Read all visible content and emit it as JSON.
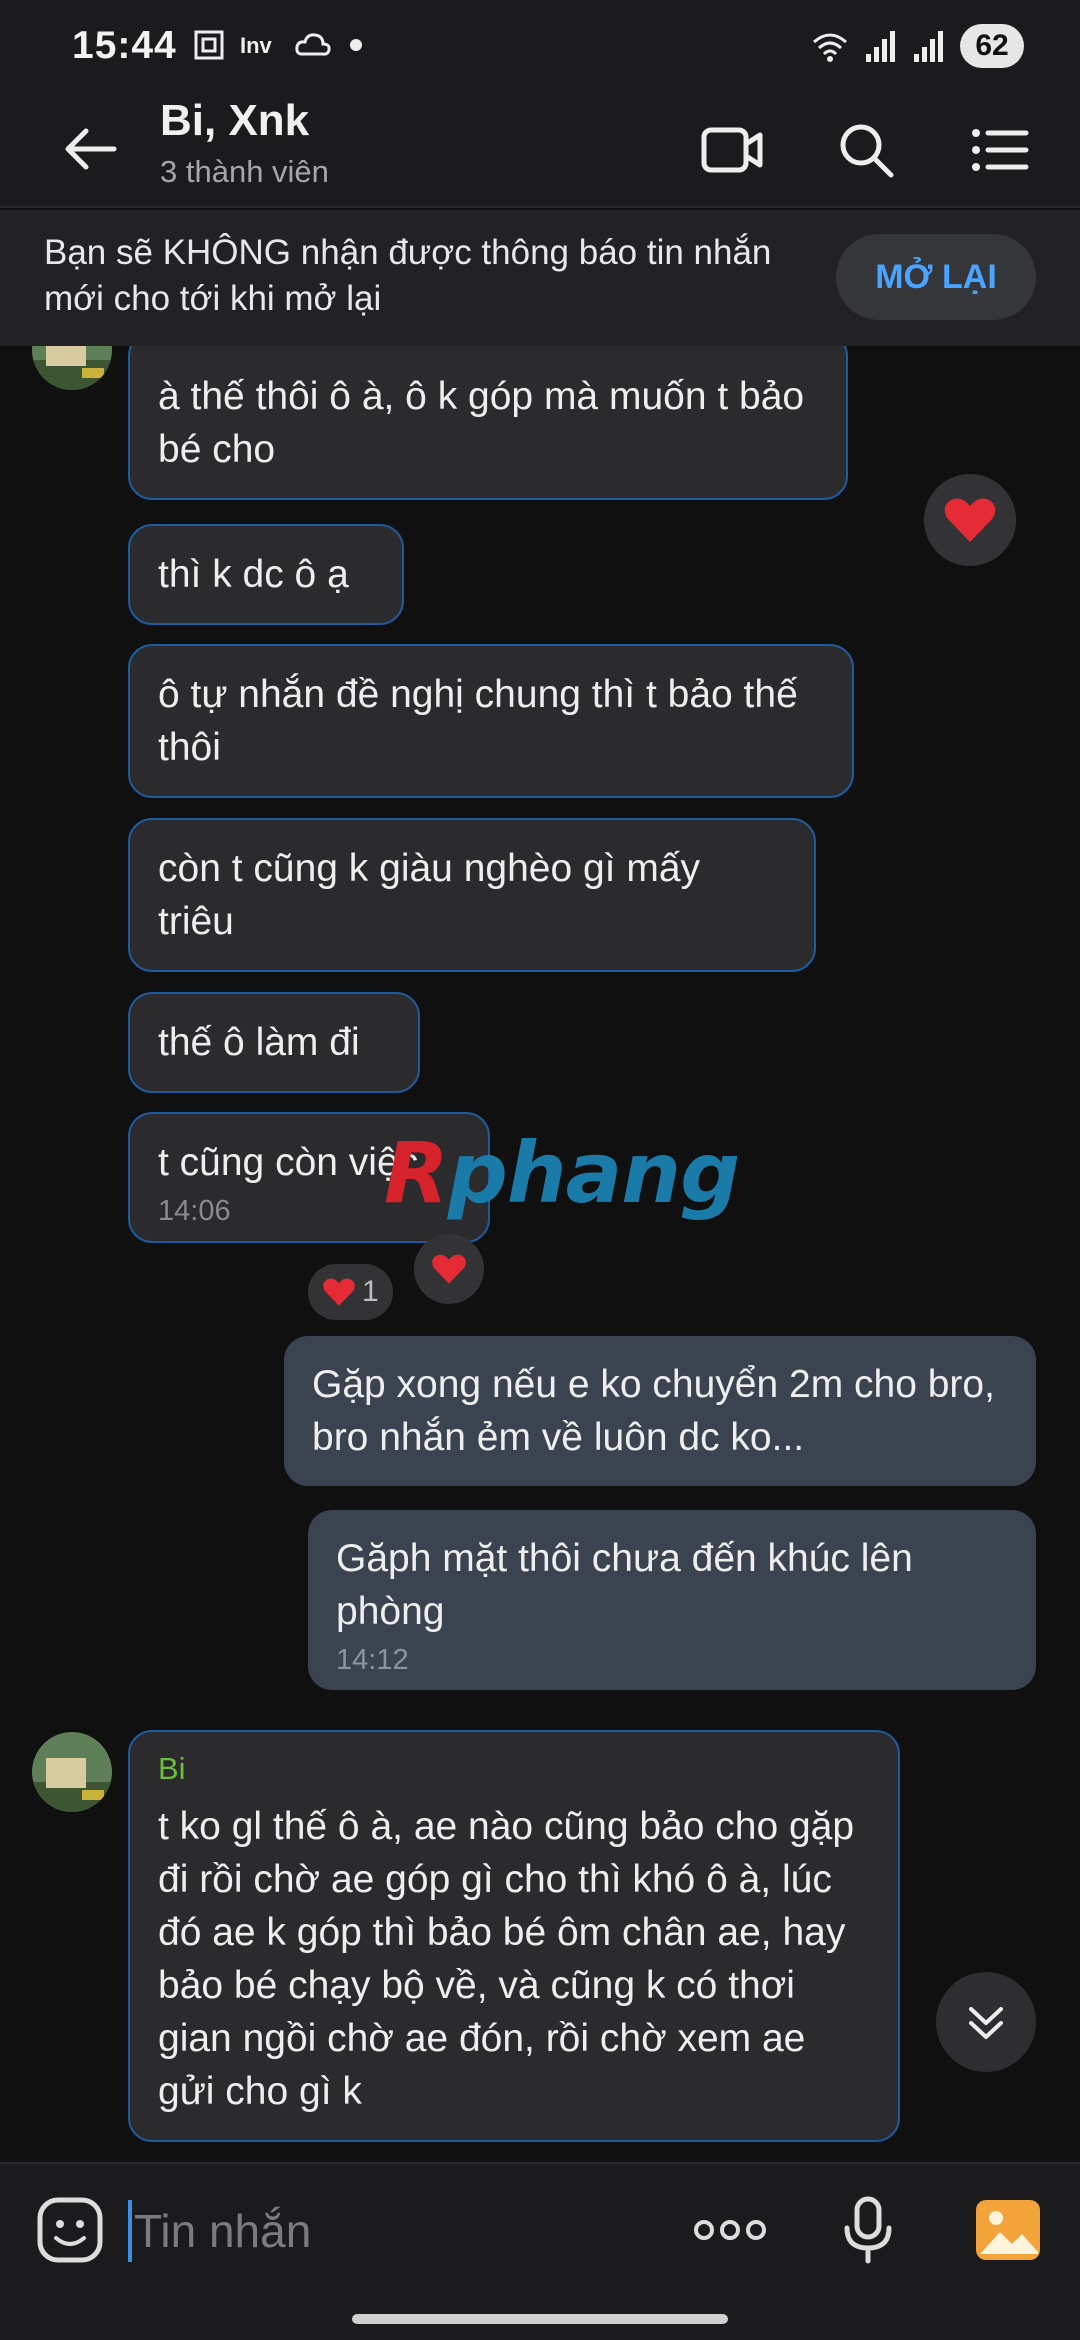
{
  "status": {
    "time": "15:44",
    "battery": "62",
    "left_icons": [
      "screenshot-icon",
      "inv-icon",
      "cloud-icon",
      "dot-icon"
    ],
    "right_icons": [
      "wifi-icon",
      "signal-icon",
      "signal-icon"
    ]
  },
  "header": {
    "title": "Bi, Xnk",
    "subtitle": "3 thành viên",
    "actions": [
      "video-call",
      "search",
      "menu"
    ]
  },
  "banner": {
    "text": "Bạn sẽ KHÔNG nhận được thông báo tin nhắn mới cho tới khi mở lại",
    "button": "MỞ LẠI"
  },
  "messages": [
    {
      "from": "in",
      "text": "à thế thôi ô à, ô k góp mà muốn t bảo bé cho"
    },
    {
      "from": "in",
      "text": "thì k dc ô ạ"
    },
    {
      "from": "in",
      "text": "ô tự nhắn đề nghị chung thì t bảo thế thôi"
    },
    {
      "from": "in",
      "text": "còn t cũng k giàu nghèo gì mấy triêu"
    },
    {
      "from": "in",
      "text": "thế ô làm đi"
    },
    {
      "from": "in",
      "text": "t cũng còn việc",
      "time": "14:06",
      "reaction_count": "1"
    },
    {
      "from": "out",
      "text": "Gặp xong nếu e ko chuyển 2m cho bro, bro nhắn ẻm về luôn dc ko..."
    },
    {
      "from": "out",
      "text": "Găph mặt thôi chưa đến khúc lên phòng",
      "time": "14:12"
    },
    {
      "from": "in",
      "sender": "Bi",
      "text": "t ko gl thế ô à, ae nào cũng bảo cho gặp đi rồi chờ ae góp gì cho thì khó ô à, lúc đó ae k góp thì bảo bé ôm chân ae, hay bảo bé chạy bộ về, và cũng k có thơi gian ngồi chờ ae đón, rồi chờ xem ae gửi cho gì k"
    }
  ],
  "watermark": {
    "prefix": "R",
    "text": "phang"
  },
  "input": {
    "placeholder": "Tin nhắn"
  },
  "colors": {
    "accent": "#4aa3ff",
    "incoming_bubble": "#2b2b2d",
    "incoming_border": "#1f5a9e",
    "outgoing_bubble": "#3b4350",
    "sender_name": "#6bbf3a",
    "background": "#101011"
  }
}
